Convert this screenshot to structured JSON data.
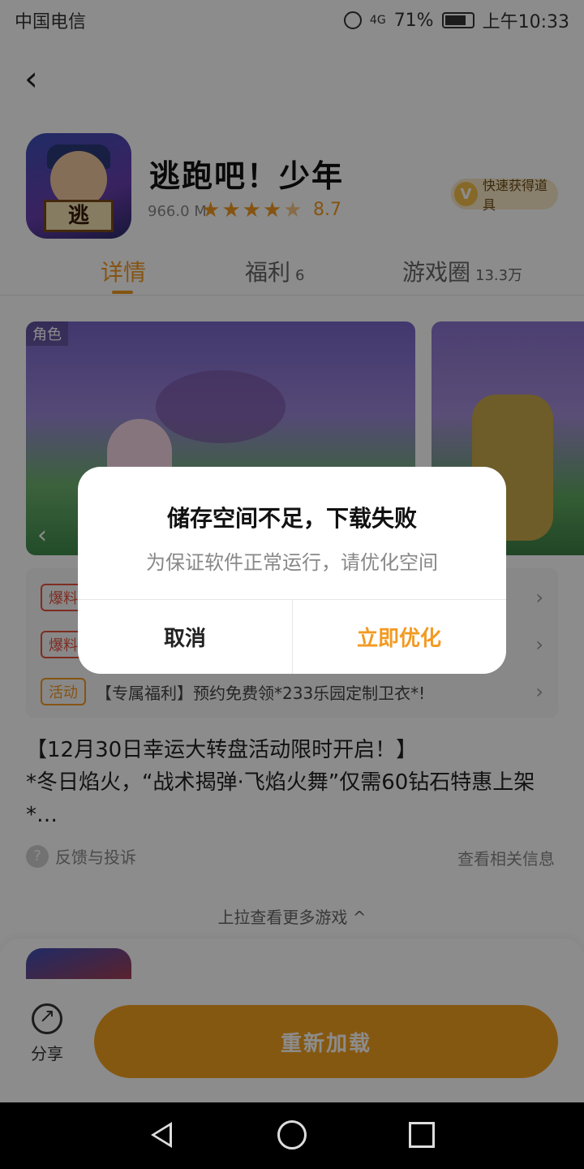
{
  "status_bar": {
    "carrier": "中国电信",
    "battery": "71%",
    "network": "4G",
    "time": "上午10:33"
  },
  "app": {
    "title": "逃跑吧！少年",
    "size": "966.0 M",
    "stars": [
      "★",
      "★",
      "★",
      "★",
      "★"
    ],
    "rating": "8.7",
    "rating_value": 4.35,
    "icon_sign": "逃",
    "promo": "快速获得道具",
    "promo_icon": "V"
  },
  "tabs": [
    {
      "label": "详情",
      "count": ""
    },
    {
      "label": "福利",
      "count": "6"
    },
    {
      "label": "游戏圈",
      "count": "13.3万"
    }
  ],
  "screenshots": {
    "label": "角色"
  },
  "info_rows": [
    {
      "tag": "爆料",
      "text": ""
    },
    {
      "tag": "爆料",
      "text": ""
    },
    {
      "tag": "活动",
      "text": "【专属福利】预约免费领*233乐园定制卫衣*!"
    }
  ],
  "description": {
    "line1": "【12月30日幸运大转盘活动限时开启！】",
    "line2": "*冬日焰火，“战术揭弹·飞焰火舞”仅需60钻石特惠上架*…"
  },
  "feedback": "反馈与投诉",
  "related": "查看相关信息",
  "more_games": "上拉查看更多游戏 ^",
  "bottom": {
    "share": "分享",
    "reload": "重新加载"
  },
  "dialog": {
    "title": "储存空间不足，下载失败",
    "message": "为保证软件正常运行，请优化空间",
    "cancel": "取消",
    "confirm": "立即优化"
  },
  "colors": {
    "accent": "#f39a22",
    "tag_red": "#e5533f",
    "button_orange": "#f3a11f"
  }
}
